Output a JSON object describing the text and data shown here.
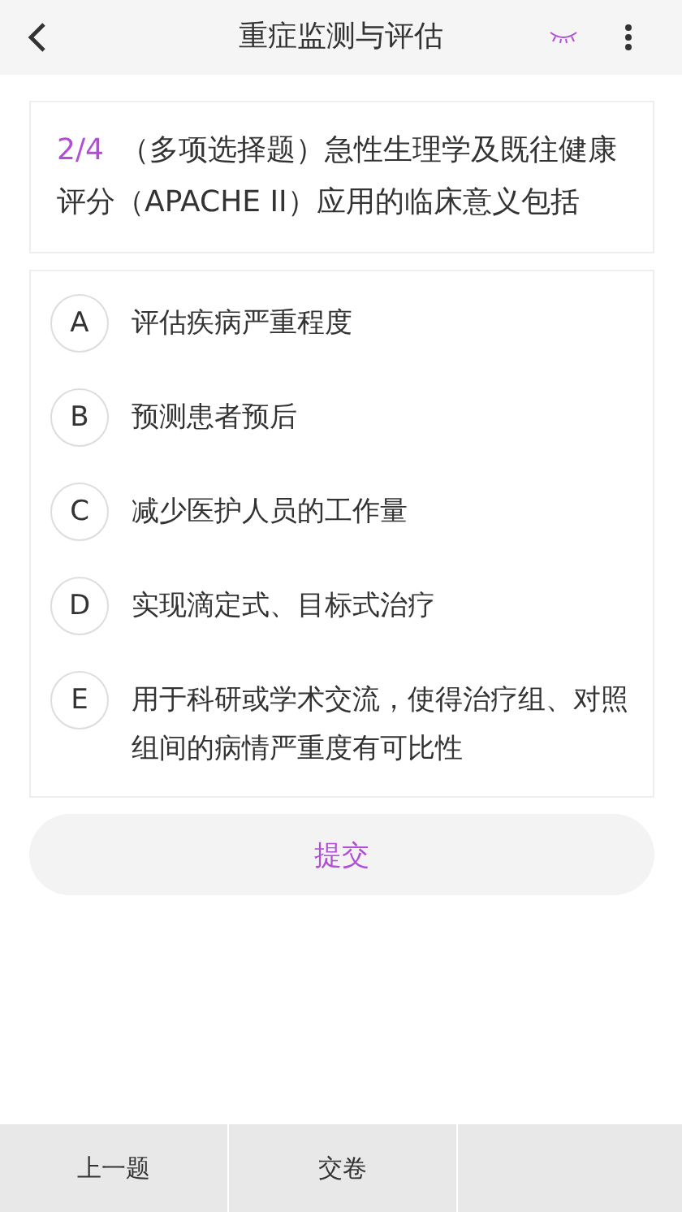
{
  "header": {
    "title": "重症监测与评估"
  },
  "question": {
    "progress": "2/4",
    "text": "（多项选择题）急性生理学及既往健康评分（APACHE II）应用的临床意义包括"
  },
  "options": [
    {
      "letter": "A",
      "text": "评估疾病严重程度",
      "selected": false
    },
    {
      "letter": "B",
      "text": "预测患者预后",
      "selected": false
    },
    {
      "letter": "C",
      "text": "减少医护人员的工作量",
      "selected": false
    },
    {
      "letter": "D",
      "text": "实现滴定式、目标式治疗",
      "selected": false
    },
    {
      "letter": "E",
      "text": "用于科研或学术交流，使得治疗组、对照组间的病情严重度有可比性",
      "selected": false
    }
  ],
  "submit": "提交",
  "bottom_bar": [
    "上一题",
    "交卷"
  ]
}
